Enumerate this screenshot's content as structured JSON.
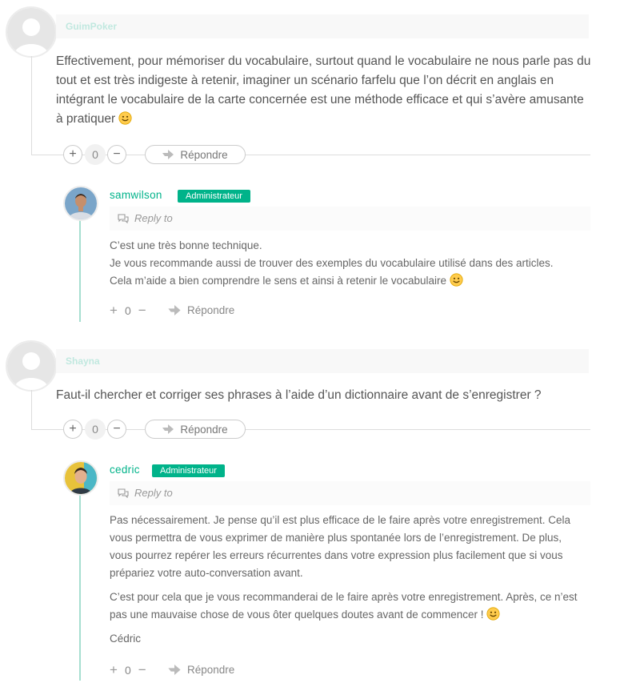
{
  "comments": [
    {
      "author": "GuimPoker",
      "text": "Effectivement, pour mémoriser du vocabulaire, surtout quand le vocabulaire ne nous parle pas du tout et est très indigeste à retenir, imaginer un scénario farfelu que l’on décrit en anglais en intégrant le vocabulaire de la carte concernée est une méthode efficace et qui s’avère amusante à pratiquer",
      "votes": "0",
      "reply_label": "Répondre",
      "reply": {
        "author": "samwilson",
        "badge": "Administrateur",
        "reply_to": "Reply to",
        "lines": [
          "C’est une très bonne technique.",
          "Je vous recommande aussi de trouver des exemples du vocabulaire utilisé dans des articles.",
          "Cela m’aide a bien comprendre le sens et ainsi à retenir le vocabulaire"
        ],
        "votes": "0",
        "plus": "+",
        "minus": "−",
        "reply_label": "Répondre"
      }
    },
    {
      "author": "Shayna",
      "text": "Faut-il chercher et corriger ses phrases à l’aide d’un dictionnaire avant de s’enregistrer ?",
      "votes": "0",
      "reply_label": "Répondre",
      "reply": {
        "author": "cedric",
        "badge": "Administrateur",
        "reply_to": "Reply to",
        "paragraphs": [
          "Pas nécessairement. Je pense qu’il est plus efficace de le faire après votre enregistrement. Cela vous permettra de vous exprimer de manière plus spontanée lors de l’enregistrement. De plus, vous pourrez repérer les erreurs récurrentes dans votre expression plus facilement que si vous prépariez votre auto-conversation avant.",
          "C’est pour cela que je vous recommanderai de le faire après votre enregistrement. Après, ce n’est pas une mauvaise chose de vous ôter quelques doutes avant de commencer !",
          "Cédric"
        ],
        "votes": "0",
        "plus": "+",
        "minus": "−",
        "reply_label": "Répondre"
      }
    }
  ],
  "vote_symbols": {
    "plus": "+",
    "minus": "−"
  },
  "colors": {
    "accent": "#00b38a",
    "reply_line": "#a7dfd0"
  }
}
